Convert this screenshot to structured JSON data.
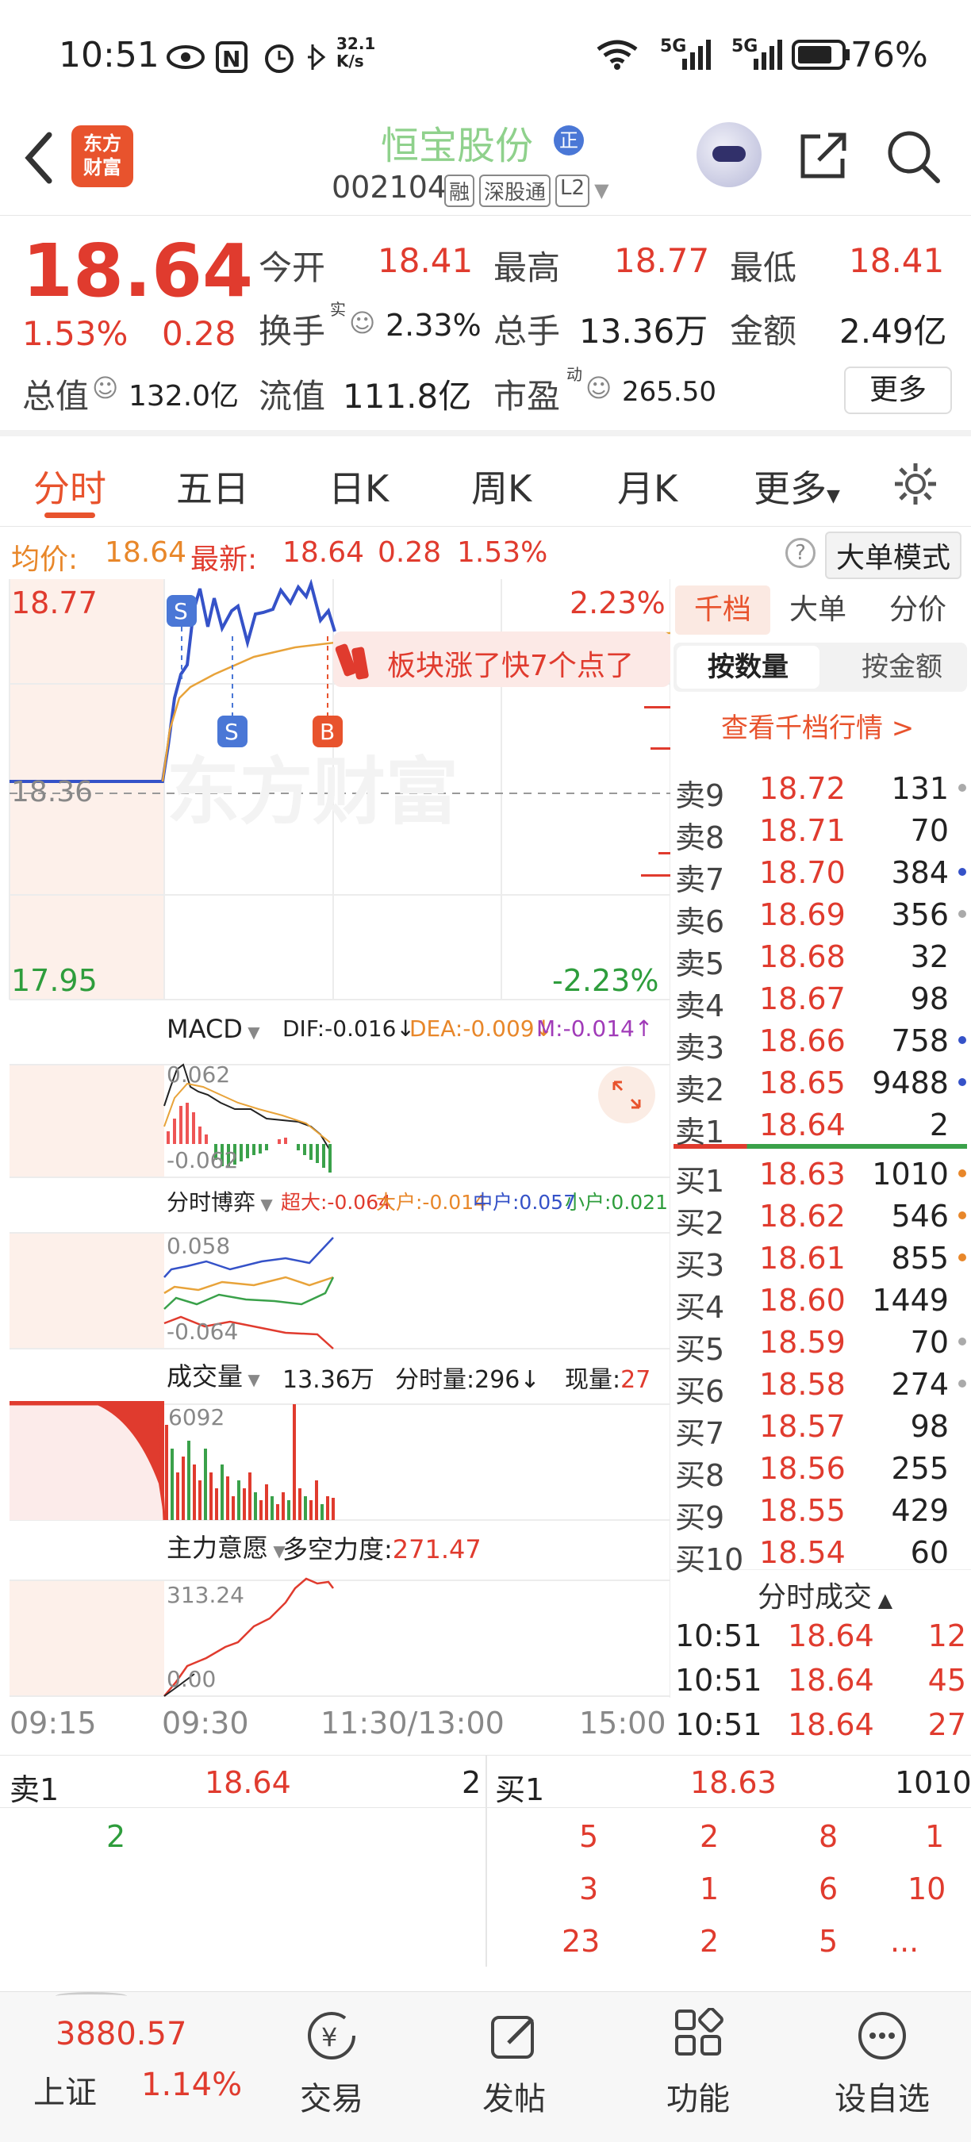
{
  "status": {
    "time": "10:51",
    "speed": "32.1\nK/s",
    "battery": "76%",
    "net1": "5G",
    "net2": "5G"
  },
  "header": {
    "name": "恒宝股份",
    "code": "002104",
    "tags": [
      "融",
      "深股通",
      "L2"
    ],
    "logo": "东方\n财富"
  },
  "quote": {
    "price": "18.64",
    "pct": "1.53%",
    "chg": "0.28",
    "open_l": "今开",
    "open_v": "18.41",
    "high_l": "最高",
    "high_v": "18.77",
    "low_l": "最低",
    "low_v": "18.41",
    "turn_l": "换手",
    "turn_sup": "实",
    "turn_v": "2.33%",
    "vol_l": "总手",
    "vol_v": "13.36万",
    "amt_l": "金额",
    "amt_v": "2.49亿",
    "mcap_l": "总值",
    "mcap_v": "132.0亿",
    "fcap_l": "流值",
    "fcap_v": "111.8亿",
    "pe_l": "市盈",
    "pe_sup": "动",
    "pe_v": "265.50",
    "more": "更多"
  },
  "tabs": [
    "分时",
    "五日",
    "日K",
    "周K",
    "月K",
    "更多"
  ],
  "infoline": {
    "avg_l": "均价:",
    "avg_v": "18.64",
    "last_l": "最新:",
    "last_v": "18.64",
    "chg": "0.28",
    "pct": "1.53%",
    "mode": "大单模式"
  },
  "chart": {
    "hi": "18.77",
    "lo": "17.95",
    "pre": "18.36",
    "hipct": "2.23%",
    "lopct": "-2.23%",
    "watermark": "东方财富",
    "banner": "板块涨了快7个点了",
    "macd_sel": "MACD",
    "dif": "DIF:-0.016↓",
    "dea": "DEA:-0.009↓",
    "m": "M:-0.014↑",
    "macd_top": "0.062",
    "macd_bot": "-0.062",
    "bo_sel": "分时博弈",
    "bo_big": "超大:-0.064",
    "bo_lg": "大户:-0.014",
    "bo_mid": "中户:0.057",
    "bo_sm": "小户:0.021",
    "bo_top": "0.058",
    "bo_bot": "-0.064",
    "vol_sel": "成交量",
    "vol_total": "13.36万",
    "vol_min": "分时量:296↓",
    "vol_now_l": "现量:",
    "vol_now": "27",
    "vol_max": "6092",
    "zl_sel": "主力意愿",
    "zl_l": "多空力度:",
    "zl_v": "271.47",
    "zl_top": "313.24",
    "zl_bot": "0.00",
    "times": [
      "09:15",
      "09:30",
      "11:30/13:00",
      "15:00"
    ]
  },
  "orderbook": {
    "tabs": [
      "千档",
      "大单",
      "分价"
    ],
    "sub": [
      "按数量",
      "按金额"
    ],
    "link": "查看千档行情 >",
    "asks": [
      [
        "卖9",
        "18.72",
        "131"
      ],
      [
        "卖8",
        "18.71",
        "70"
      ],
      [
        "卖7",
        "18.70",
        "384"
      ],
      [
        "卖6",
        "18.69",
        "356"
      ],
      [
        "卖5",
        "18.68",
        "32"
      ],
      [
        "卖4",
        "18.67",
        "98"
      ],
      [
        "卖3",
        "18.66",
        "758"
      ],
      [
        "卖2",
        "18.65",
        "9488"
      ],
      [
        "卖1",
        "18.64",
        "2"
      ]
    ],
    "bids": [
      [
        "买1",
        "18.63",
        "1010"
      ],
      [
        "买2",
        "18.62",
        "546"
      ],
      [
        "买3",
        "18.61",
        "855"
      ],
      [
        "买4",
        "18.60",
        "1449"
      ],
      [
        "买5",
        "18.59",
        "70"
      ],
      [
        "买6",
        "18.58",
        "274"
      ],
      [
        "买7",
        "18.57",
        "98"
      ],
      [
        "买8",
        "18.56",
        "255"
      ],
      [
        "买9",
        "18.55",
        "429"
      ],
      [
        "买10",
        "18.54",
        "60"
      ]
    ],
    "ticks_title": "分时成交",
    "ticks": [
      [
        "10:51",
        "18.64",
        "12"
      ],
      [
        "10:51",
        "18.64",
        "45"
      ],
      [
        "10:51",
        "18.64",
        "27"
      ]
    ]
  },
  "bottomq": {
    "s1_l": "卖1",
    "s1_p": "18.64",
    "s1_q": "2",
    "b1_l": "买1",
    "b1_p": "18.63",
    "b1_q": "1010",
    "s_queue": "2",
    "b_queue": [
      "5",
      "2",
      "8",
      "1",
      "3",
      "1",
      "6",
      "10",
      "23",
      "2",
      "5",
      "..."
    ]
  },
  "nav": {
    "index_v": "3880.57",
    "index_l": "上证",
    "index_pct": "1.14%",
    "items": [
      "交易",
      "发帖",
      "功能",
      "设自选"
    ]
  }
}
